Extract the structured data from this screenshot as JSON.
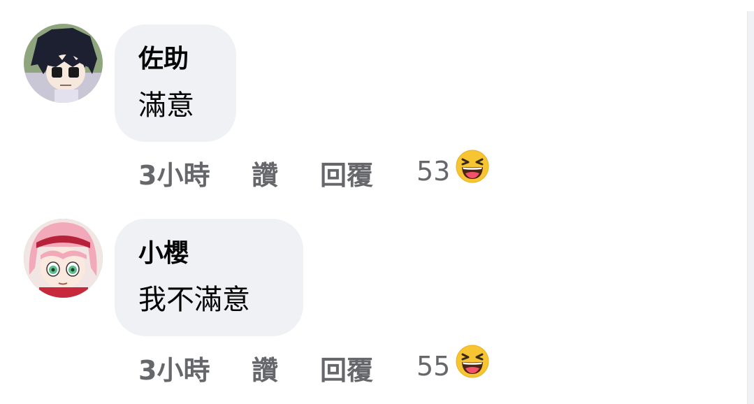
{
  "comments": [
    {
      "author": "佐助",
      "text": "滿意",
      "time": "3小時",
      "like_label": "讚",
      "reply_label": "回覆",
      "reaction_count": "53",
      "reaction_icon": "haha-emoji-icon"
    },
    {
      "author": "小櫻",
      "text": "我不滿意",
      "time": "3小時",
      "like_label": "讚",
      "reply_label": "回覆",
      "reaction_count": "55",
      "reaction_icon": "haha-emoji-icon"
    }
  ],
  "colors": {
    "bubble": "#f0f1f5",
    "secondary_text": "#65676b",
    "primary_text": "#050505",
    "haha_yellow": "#f7c531"
  }
}
